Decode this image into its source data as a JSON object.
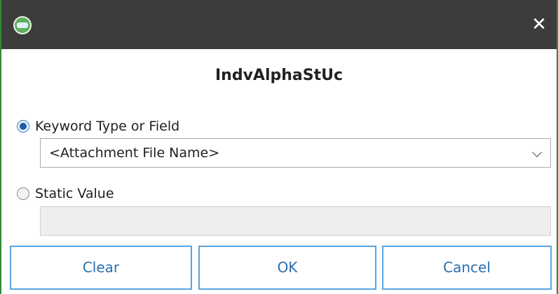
{
  "window": {
    "app_icon": "onbase-logo-icon",
    "close_glyph": "✕",
    "title": "IndvAlphaStUc"
  },
  "options": {
    "keyword_type": {
      "label": "Keyword Type or Field",
      "selected": true,
      "dropdown_value": "<Attachment File Name>"
    },
    "static_value": {
      "label": "Static Value",
      "selected": false,
      "input_value": ""
    }
  },
  "buttons": {
    "clear": "Clear",
    "ok": "OK",
    "cancel": "Cancel"
  },
  "colors": {
    "titlebar": "#3c3c3c",
    "window_border": "#2e8b2e",
    "button_border": "#5ba3e0",
    "button_text": "#2a6fb0"
  }
}
